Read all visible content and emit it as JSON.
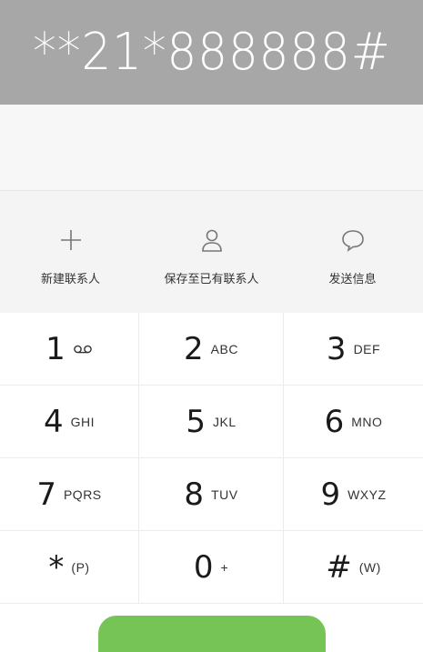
{
  "dialer": {
    "number": "**21*888888#"
  },
  "actions": [
    {
      "label": "新建联系人",
      "icon": "plus-icon"
    },
    {
      "label": "保存至已有联系人",
      "icon": "person-icon"
    },
    {
      "label": "发送信息",
      "icon": "message-bubble-icon"
    }
  ],
  "keys": [
    {
      "digit": "1",
      "sub": ""
    },
    {
      "digit": "2",
      "sub": "ABC"
    },
    {
      "digit": "3",
      "sub": "DEF"
    },
    {
      "digit": "4",
      "sub": "GHI"
    },
    {
      "digit": "5",
      "sub": "JKL"
    },
    {
      "digit": "6",
      "sub": "MNO"
    },
    {
      "digit": "7",
      "sub": "PQRS"
    },
    {
      "digit": "8",
      "sub": "TUV"
    },
    {
      "digit": "9",
      "sub": "WXYZ"
    },
    {
      "digit": "*",
      "sub": "(P)"
    },
    {
      "digit": "0",
      "sub": "+"
    },
    {
      "digit": "#",
      "sub": "(W)"
    }
  ],
  "colors": {
    "header": "#a7a7a7",
    "call_button": "#76c356"
  }
}
